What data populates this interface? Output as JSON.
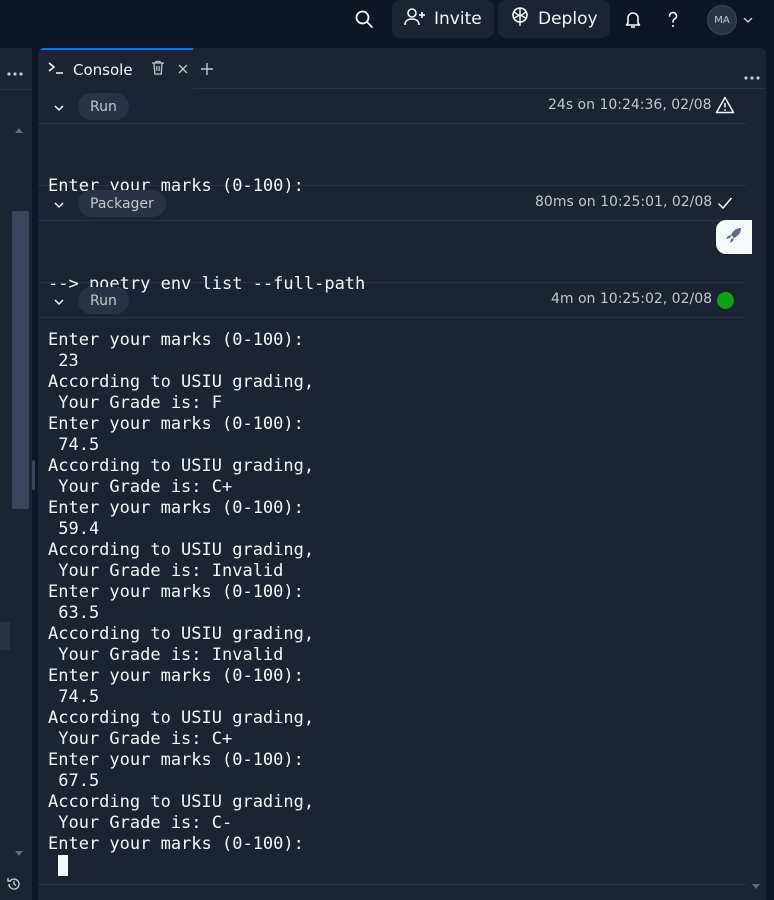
{
  "topbar": {
    "invite_label": "Invite",
    "deploy_label": "Deploy",
    "avatar_initials": "MA"
  },
  "console": {
    "tab_title": "Console",
    "sections": [
      {
        "pill": "Run",
        "meta": "24s on 10:24:36, 02/08",
        "status": "warning-icon",
        "lines": [
          "Enter your marks (0-100):"
        ]
      },
      {
        "pill": "Packager",
        "meta": "80ms on 10:25:01, 02/08",
        "status": "check-icon",
        "lines": [
          "--> poetry env list --full-path"
        ]
      },
      {
        "pill": "Run",
        "meta": "4m on 10:25:02, 02/08",
        "status": "running-dot",
        "lines": [
          "Enter your marks (0-100):",
          " 23",
          "According to USIU grading,",
          " Your Grade is: F",
          "Enter your marks (0-100):",
          " 74.5",
          "According to USIU grading,",
          " Your Grade is: C+",
          "Enter your marks (0-100):",
          " 59.4",
          "According to USIU grading,",
          " Your Grade is: Invalid",
          "Enter your marks (0-100):",
          " 63.5",
          "According to USIU grading,",
          " Your Grade is: Invalid",
          "Enter your marks (0-100):",
          " 74.5",
          "According to USIU grading,",
          " Your Grade is: C+",
          "Enter your marks (0-100):",
          " 67.5",
          "According to USIU grading,",
          " Your Grade is: C-",
          "Enter your marks (0-100):"
        ]
      }
    ]
  },
  "colors": {
    "background": "#0e1525",
    "panel": "#1c2333",
    "pill": "#2b3245",
    "accent": "#0079f2",
    "running": "#0ca30c",
    "text": "#f5f9fc",
    "muted": "#c2c8cc"
  }
}
